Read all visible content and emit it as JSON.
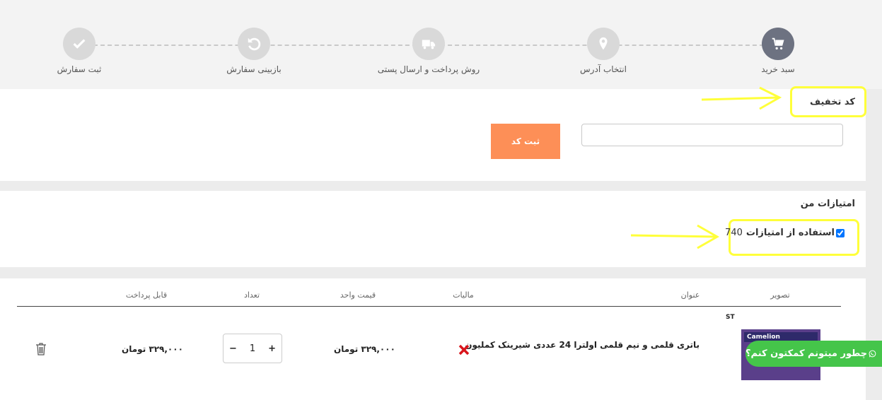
{
  "steps": [
    {
      "label": "سبد خرید",
      "icon": "cart-icon",
      "active": true
    },
    {
      "label": "انتخاب آدرس",
      "icon": "location-pin-icon",
      "active": false
    },
    {
      "label": "روش پرداخت و ارسال پستی",
      "icon": "truck-icon",
      "active": false
    },
    {
      "label": "بازبینی سفارش",
      "icon": "refresh-icon",
      "active": false
    },
    {
      "label": "ثبت سفارش",
      "icon": "check-icon",
      "active": false
    }
  ],
  "coupon": {
    "title": "کد تخفیف",
    "input_value": "",
    "submit_label": "ثبت کد"
  },
  "points": {
    "title": "امتیازات من",
    "checkbox_label": "استفاده از امتیازات",
    "points_value": "740",
    "checked": true
  },
  "cart_table": {
    "headers": {
      "image": "تصویر",
      "title": "عنوان",
      "tax": "مالیات",
      "unit_price": "قیمت واحد",
      "quantity": "تعداد",
      "payable": "قابل پرداخت"
    },
    "rows": [
      {
        "title": "باتری قلمی و نیم قلمی اولترا 24 عددی شیرینک کملیون",
        "tax_icon": "cross-icon",
        "unit_price": "۳۲۹,۰۰۰ تومان",
        "quantity": "1",
        "payable": "۳۲۹,۰۰۰ تومان",
        "thumb_brand": "Camelion",
        "thumb_logo": "ST"
      }
    ]
  },
  "help_widget": {
    "label": "چطور میتونم کمکتون کنم؟",
    "icon": "whatsapp-icon"
  },
  "colors": {
    "accent_button": "#fd8f57",
    "active_step": "#6d7281",
    "inactive_step": "#d9d9d9",
    "help_green": "#45c54a",
    "highlight": "#ffff3a",
    "tax_cross": "#d9151c"
  }
}
